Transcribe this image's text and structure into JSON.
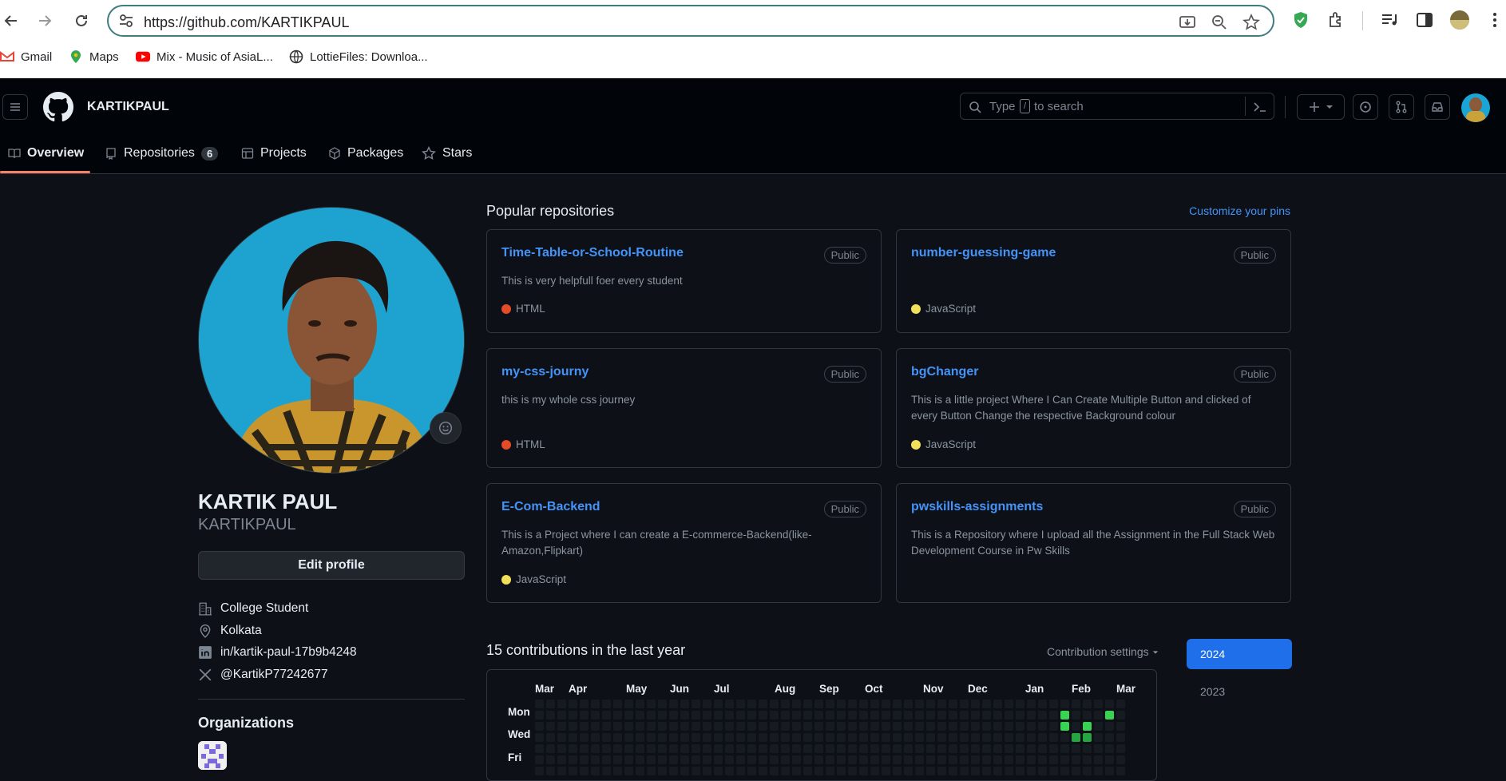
{
  "browser": {
    "url": "https://github.com/KARTIKPAUL",
    "bookmarks": [
      "Gmail",
      "Maps",
      "Mix - Music of AsiaL...",
      "LottieFiles: Downloa..."
    ]
  },
  "header": {
    "username": "KARTIKPAUL",
    "search_prefix": "Type",
    "search_key": "/",
    "search_suffix": "to search"
  },
  "tabs": [
    {
      "label": "Overview"
    },
    {
      "label": "Repositories",
      "count": "6"
    },
    {
      "label": "Projects"
    },
    {
      "label": "Packages"
    },
    {
      "label": "Stars"
    }
  ],
  "profile": {
    "name": "KARTIK PAUL",
    "login": "KARTIKPAUL",
    "edit_label": "Edit profile",
    "company": "College Student",
    "location": "Kolkata",
    "linkedin": "in/kartik-paul-17b9b4248",
    "twitter": "@KartikP77242677",
    "orgs_heading": "Organizations"
  },
  "popular": {
    "heading": "Popular repositories",
    "customize": "Customize your pins",
    "repos": [
      {
        "name": "Time-Table-or-School-Routine",
        "visibility": "Public",
        "desc": "This is very helpfull foer every student",
        "lang": "HTML",
        "color": "#e34c26"
      },
      {
        "name": "number-guessing-game",
        "visibility": "Public",
        "desc": "",
        "lang": "JavaScript",
        "color": "#f1e05a"
      },
      {
        "name": "my-css-journy",
        "visibility": "Public",
        "desc": "this is my whole css journey",
        "lang": "HTML",
        "color": "#e34c26"
      },
      {
        "name": "bgChanger",
        "visibility": "Public",
        "desc": "This is a little project Where I Can Create Multiple Button and clicked of every Button Change the respective Background colour",
        "lang": "JavaScript",
        "color": "#f1e05a"
      },
      {
        "name": "E-Com-Backend",
        "visibility": "Public",
        "desc": "This is a Project where I can create a E-commerce-Backend(like-Amazon,Flipkart)",
        "lang": "JavaScript",
        "color": "#f1e05a"
      },
      {
        "name": "pwskills-assignments",
        "visibility": "Public",
        "desc": "This is a Repository where I upload all the Assignment in the Full Stack Web Development Course in Pw Skills",
        "lang": "",
        "color": ""
      }
    ]
  },
  "contributions": {
    "heading": "15 contributions in the last year",
    "settings": "Contribution settings",
    "years": [
      "2024",
      "2023"
    ],
    "months": [
      "Mar",
      "Apr",
      "May",
      "Jun",
      "Jul",
      "Aug",
      "Sep",
      "Oct",
      "Nov",
      "Dec",
      "Jan",
      "Feb",
      "Mar"
    ],
    "days": [
      "Mon",
      "Wed",
      "Fri"
    ],
    "active_cells": [
      {
        "week": 47,
        "day": 1
      },
      {
        "week": 47,
        "day": 2
      },
      {
        "week": 48,
        "day": 3
      },
      {
        "week": 49,
        "day": 2
      },
      {
        "week": 49,
        "day": 3
      },
      {
        "week": 51,
        "day": 1
      }
    ],
    "colors": {
      "empty": "#161b22",
      "active": "#39d353",
      "active_dim": "#26a641"
    }
  },
  "colors": {
    "bg": "#0d1117",
    "link": "#4493f8",
    "selected_year": "#1f6feb"
  }
}
